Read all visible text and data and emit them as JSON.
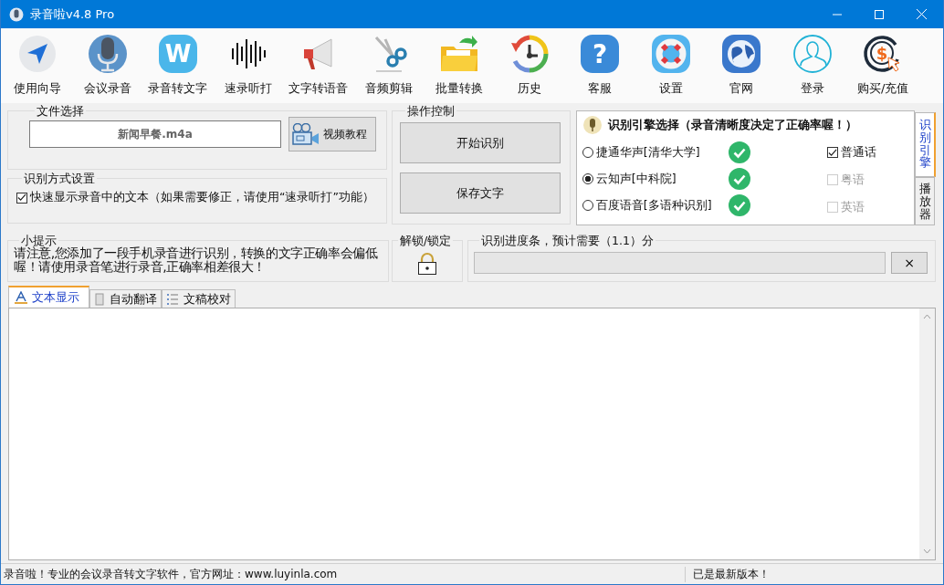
{
  "window": {
    "title": "录音啦v4.8 Pro"
  },
  "toolbar": [
    {
      "label": "使用向导",
      "kind": "guide"
    },
    {
      "label": "会议录音",
      "kind": "mic"
    },
    {
      "label": "录音转文字",
      "kind": "letter",
      "glyph": "W"
    },
    {
      "label": "速录听打",
      "kind": "wave"
    },
    {
      "label": "文字转语音",
      "kind": "megaphone"
    },
    {
      "label": "音频剪辑",
      "kind": "scissors"
    },
    {
      "label": "批量转换",
      "kind": "folder"
    },
    {
      "label": "历史",
      "kind": "history"
    },
    {
      "label": "客服",
      "kind": "help",
      "glyph": "?"
    },
    {
      "label": "设置",
      "kind": "lifebuoy"
    },
    {
      "label": "官网",
      "kind": "globe"
    },
    {
      "label": "登录",
      "kind": "user"
    },
    {
      "label": "购买/充值",
      "kind": "dollar",
      "glyph": "$"
    }
  ],
  "file_select": {
    "legend": "文件选择",
    "file_name": "新闻早餐.m4a",
    "button": "视频教程"
  },
  "mode": {
    "legend": "识别方式设置",
    "option": {
      "label": "快速显示录音中的文本（如果需要修正，请使用“速录听打”功能）",
      "checked": true
    }
  },
  "operations": {
    "legend": "操作控制",
    "buttons": [
      "开始识别",
      "保存文字"
    ]
  },
  "engine": {
    "title": "识别引擎选择（录音清晰度决定了正确率喔！）",
    "engines": [
      {
        "label": "捷通华声[清华大学]",
        "selected": false
      },
      {
        "label": "云知声[中科院]",
        "selected": true
      },
      {
        "label": "百度语音[多语种识别]",
        "selected": false
      }
    ],
    "languages": [
      {
        "label": "普通话",
        "checked": true,
        "disabled": false
      },
      {
        "label": "粤语",
        "checked": false,
        "disabled": true
      },
      {
        "label": "英语",
        "checked": false,
        "disabled": true
      }
    ]
  },
  "side_tabs": [
    {
      "label": "识别引擎",
      "selected": true
    },
    {
      "label": "播放器",
      "selected": false
    }
  ],
  "tips": {
    "legend": "小提示",
    "text": "请注意,您添加了一段手机录音进行识别，转换的文字正确率会偏低喔！请使用录音笔进行录音,正确率相差很大！"
  },
  "lock": {
    "legend": "解锁/锁定"
  },
  "progress": {
    "legend": "识别进度条，预计需要（1.1）分",
    "level": 0,
    "cancel": "×"
  },
  "doc_tabs": [
    {
      "label": "文本显示",
      "selected": true,
      "kind": "font"
    },
    {
      "label": "自动翻译",
      "selected": false,
      "kind": "page"
    },
    {
      "label": "文稿校对",
      "selected": false,
      "kind": "list"
    }
  ],
  "status_bar": {
    "left": "录音啦！专业的会议录音转文字软件，官方网址：www.luyinla.com",
    "right": "已是最新版本！"
  }
}
